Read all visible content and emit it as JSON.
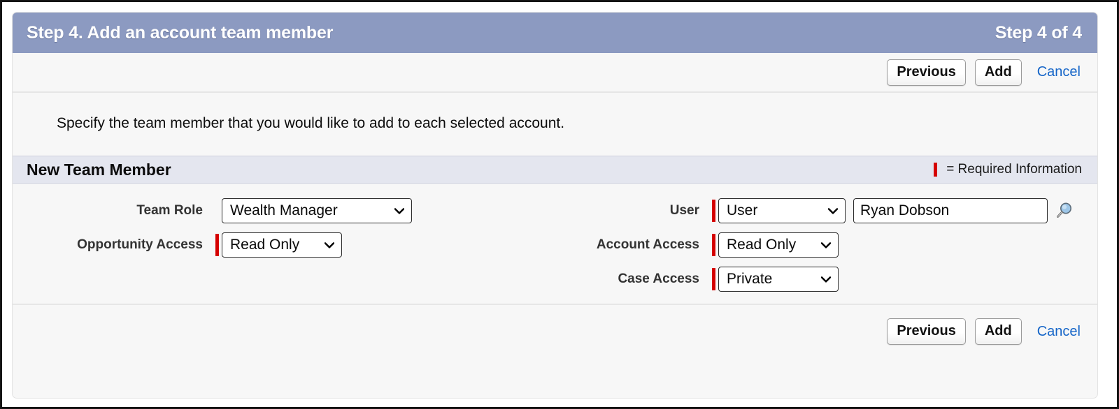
{
  "header": {
    "title": "Step 4. Add an account team member",
    "step_counter": "Step 4 of 4"
  },
  "toolbar": {
    "previous_label": "Previous",
    "add_label": "Add",
    "cancel_label": "Cancel"
  },
  "instructions": {
    "text": "Specify the team member that you would like to add to each selected account."
  },
  "section": {
    "title": "New Team Member",
    "required_legend": "= Required Information"
  },
  "fields": {
    "team_role": {
      "label": "Team Role",
      "value": "Wealth Manager",
      "required": false
    },
    "opportunity_access": {
      "label": "Opportunity Access",
      "value": "Read Only",
      "required": true
    },
    "user": {
      "label": "User",
      "type_value": "User",
      "name_value": "Ryan Dobson",
      "required": true,
      "lookup_icon": "magnifying-glass-lookup-icon"
    },
    "account_access": {
      "label": "Account Access",
      "value": "Read Only",
      "required": true
    },
    "case_access": {
      "label": "Case Access",
      "value": "Private",
      "required": true
    }
  },
  "colors": {
    "header_bg": "#8c9ac1",
    "section_bg": "#e4e6ef",
    "required_red": "#d50000",
    "link_blue": "#1565c8",
    "page_bg": "#f7f7f7"
  }
}
